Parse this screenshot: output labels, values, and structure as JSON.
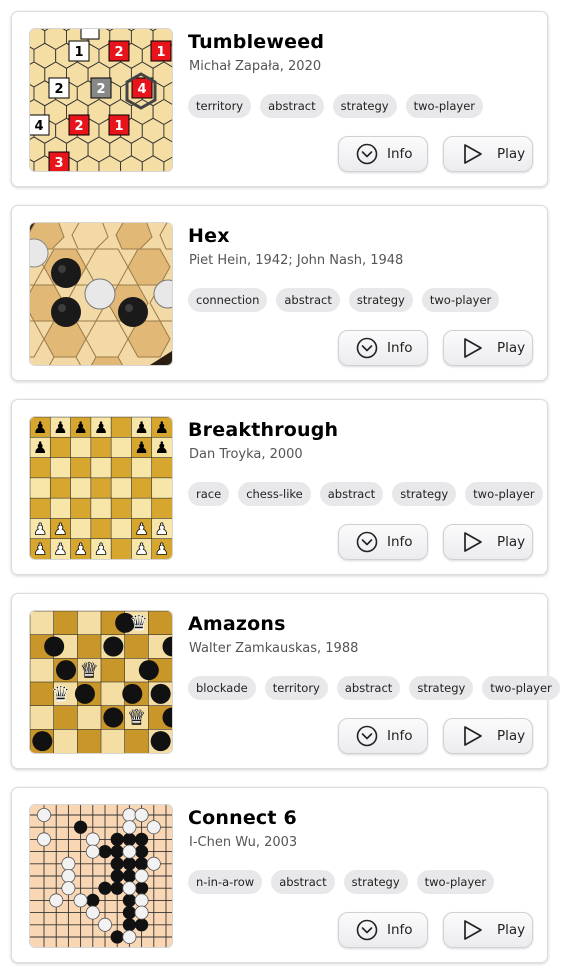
{
  "colors": {
    "tag_bg": "#e8e8ea",
    "card_border": "#dcdcdc",
    "red_cell": "#e8141b",
    "board_light": "#f5dea4",
    "board_dark": "#c9962a"
  },
  "games": [
    {
      "title": "Tumbleweed",
      "author": "Michał Zapała, 2020",
      "tags": [
        "territory",
        "abstract",
        "strategy",
        "two-player"
      ],
      "info_label": "Info",
      "play_label": "Play",
      "thumb_numbers": [
        "1",
        "2",
        "1",
        "2",
        "2",
        "4",
        "4",
        "2",
        "1",
        "3"
      ]
    },
    {
      "title": "Hex",
      "author": "Piet Hein, 1942; John Nash, 1948",
      "tags": [
        "connection",
        "abstract",
        "strategy",
        "two-player"
      ],
      "info_label": "Info",
      "play_label": "Play"
    },
    {
      "title": "Breakthrough",
      "author": "Dan Troyka, 2000",
      "tags": [
        "race",
        "chess-like",
        "abstract",
        "strategy",
        "two-player"
      ],
      "info_label": "Info",
      "play_label": "Play"
    },
    {
      "title": "Amazons",
      "author": "Walter Zamkauskas, 1988",
      "tags": [
        "blockade",
        "territory",
        "abstract",
        "strategy",
        "two-player"
      ],
      "info_label": "Info",
      "play_label": "Play"
    },
    {
      "title": "Connect 6",
      "author": "I-Chen Wu, 2003",
      "tags": [
        "n-in-a-row",
        "abstract",
        "strategy",
        "two-player"
      ],
      "info_label": "Info",
      "play_label": "Play"
    }
  ],
  "icons": {
    "info": "chevron-down-circle-icon",
    "play": "play-triangle-icon"
  }
}
